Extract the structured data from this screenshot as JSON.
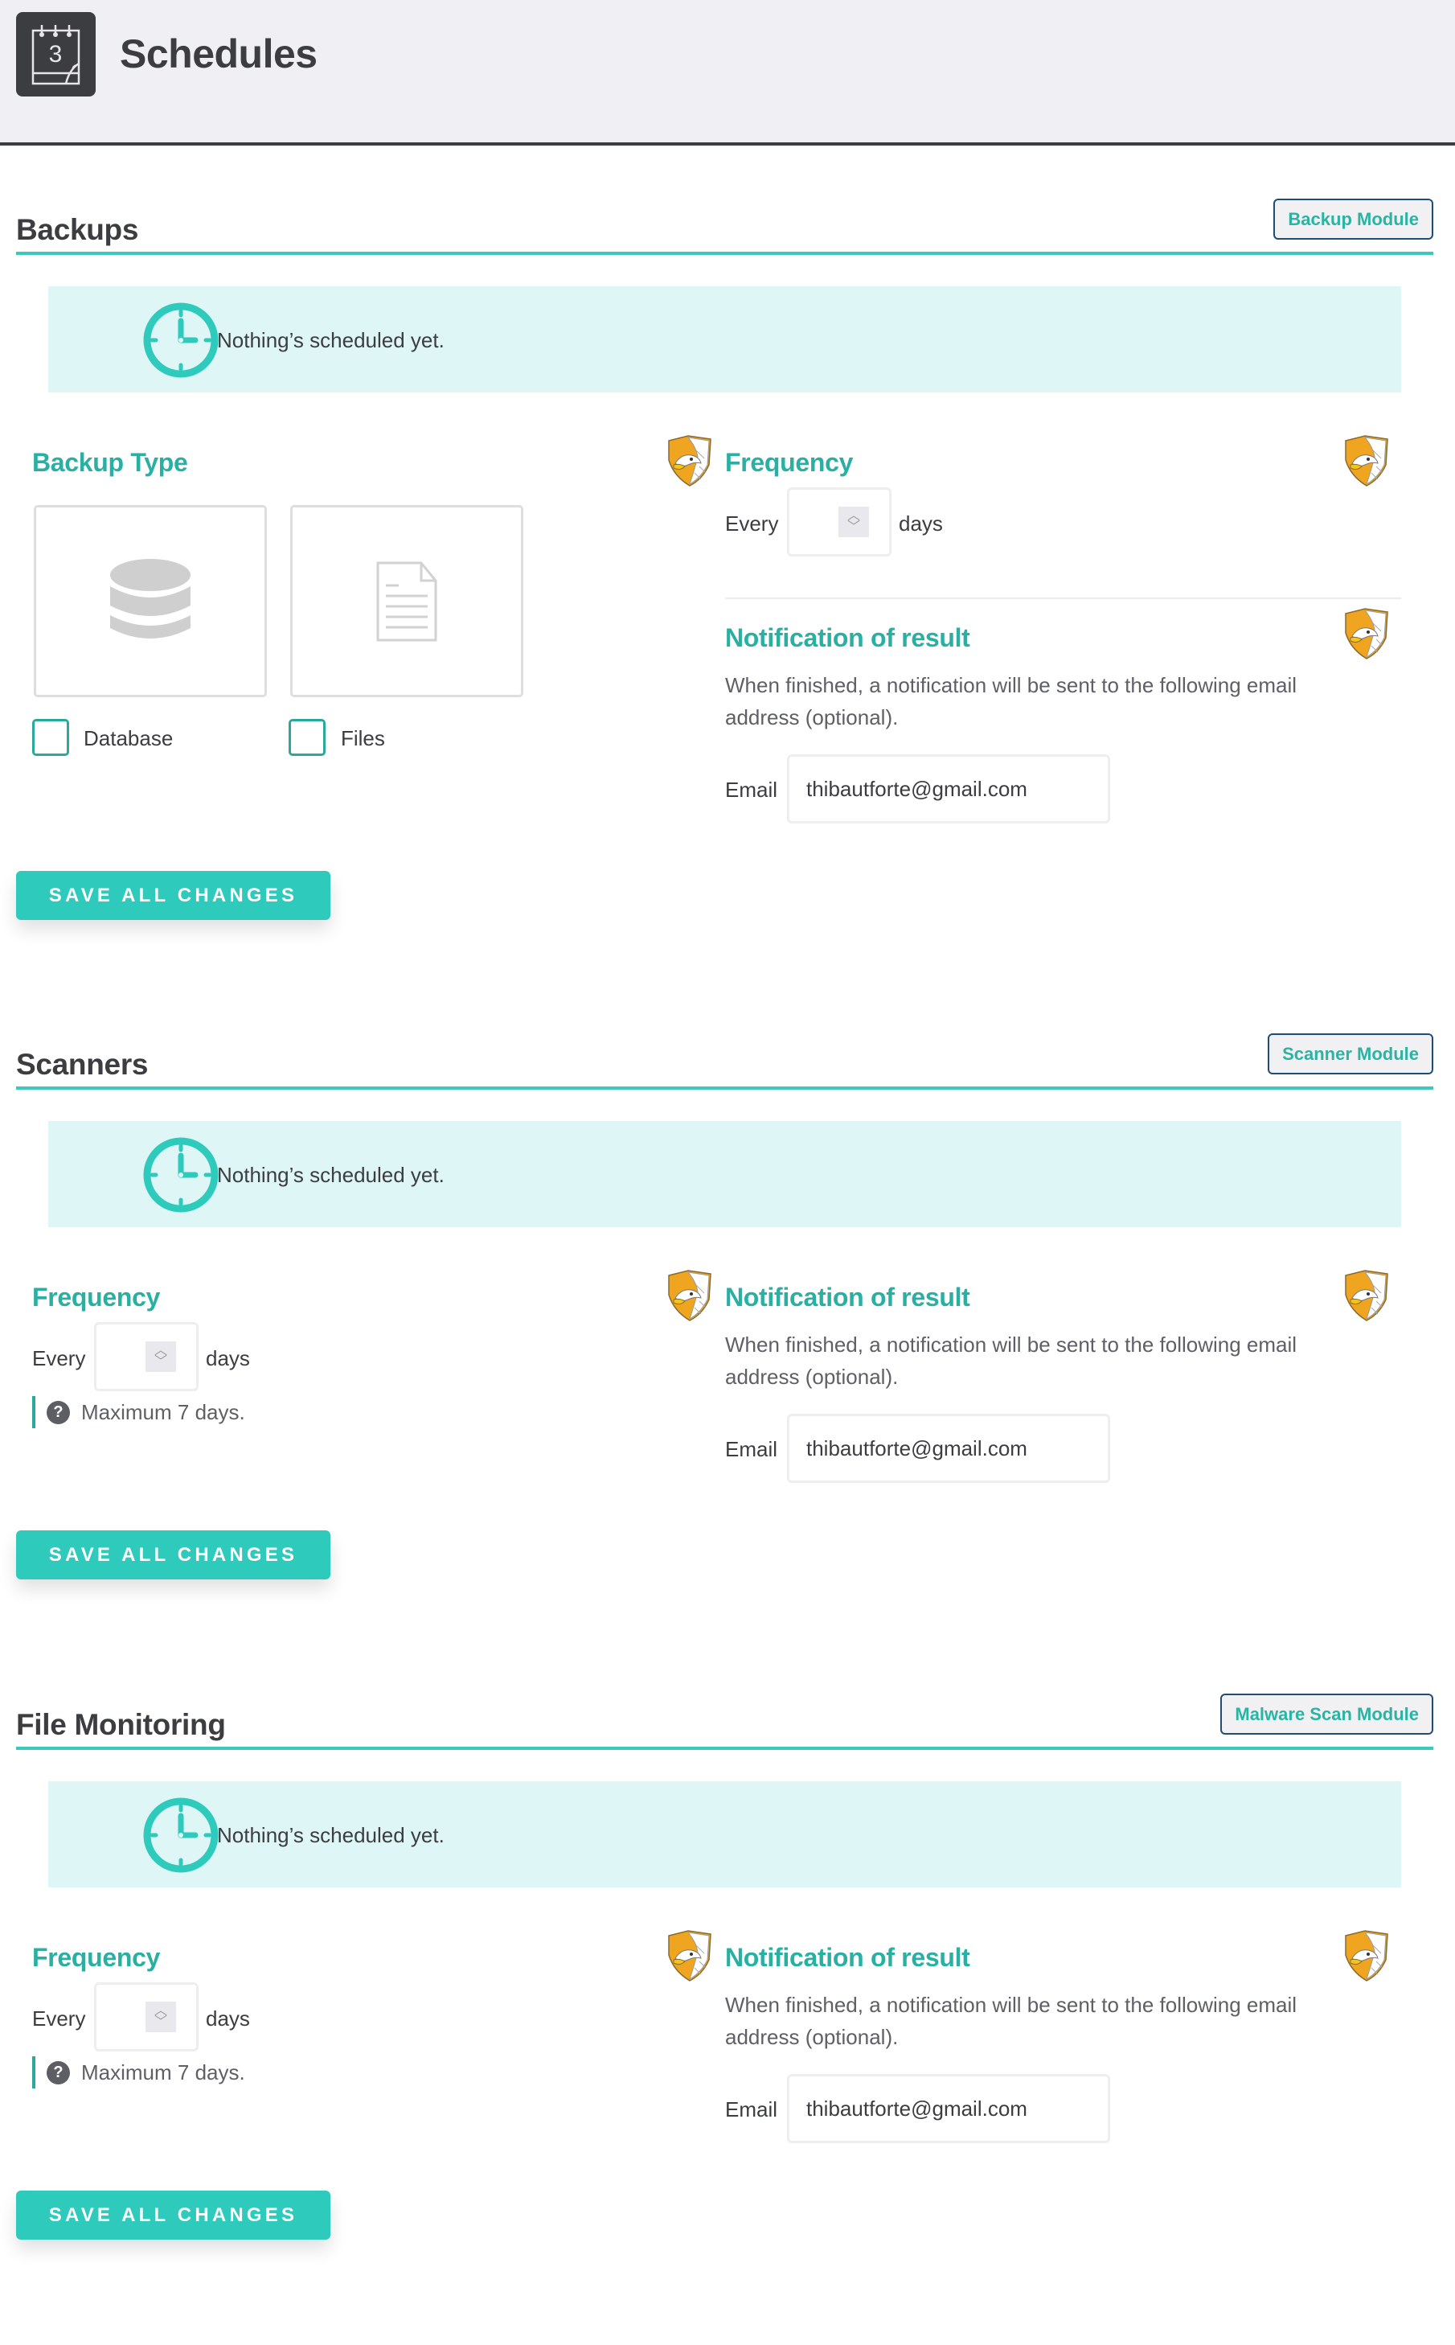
{
  "header": {
    "title": "Schedules",
    "icon": "calendar-icon",
    "calendar_day": "3"
  },
  "colors": {
    "accent": "#2ecbbc",
    "accent_text": "#29b0a2",
    "notice_bg": "#def6f6",
    "header_bg": "#f0f0f4",
    "dark": "#3c3d41",
    "module_border": "#1e4e76"
  },
  "sections": {
    "backups": {
      "title": "Backups",
      "module_button": "Backup Module",
      "notice": "Nothing’s scheduled yet.",
      "backup_type": {
        "title": "Backup Type",
        "options": [
          {
            "label": "Database",
            "icon": "database-icon",
            "checked": false
          },
          {
            "label": "Files",
            "icon": "file-icon",
            "checked": false
          }
        ]
      },
      "frequency": {
        "title": "Frequency",
        "prefix": "Every",
        "value": "",
        "suffix": "days"
      },
      "notification": {
        "title": "Notification of result",
        "description": "When finished, a notification will be sent to the following email address (optional).",
        "email_label": "Email",
        "email_value": "thibautforte@gmail.com"
      },
      "save_button": "SAVE ALL CHANGES"
    },
    "scanners": {
      "title": "Scanners",
      "module_button": "Scanner Module",
      "notice": "Nothing’s scheduled yet.",
      "frequency": {
        "title": "Frequency",
        "prefix": "Every",
        "value": "",
        "suffix": "days",
        "hint": "Maximum 7 days."
      },
      "notification": {
        "title": "Notification of result",
        "description": "When finished, a notification will be sent to the following email address (optional).",
        "email_label": "Email",
        "email_value": "thibautforte@gmail.com"
      },
      "save_button": "SAVE ALL CHANGES"
    },
    "file_monitoring": {
      "title": "File Monitoring",
      "module_button": "Malware Scan Module",
      "notice": "Nothing’s scheduled yet.",
      "frequency": {
        "title": "Frequency",
        "prefix": "Every",
        "value": "",
        "suffix": "days",
        "hint": "Maximum 7 days."
      },
      "notification": {
        "title": "Notification of result",
        "description": "When finished, a notification will be sent to the following email address (optional).",
        "email_label": "Email",
        "email_value": "thibautforte@gmail.com"
      },
      "save_button": "SAVE ALL CHANGES"
    }
  },
  "icons": {
    "pro_badge": "eagle-shield-icon",
    "notice": "clock-icon",
    "hint": "question-circle-icon",
    "spinner_up": "chevron-up-icon",
    "spinner_down": "chevron-down-icon"
  }
}
